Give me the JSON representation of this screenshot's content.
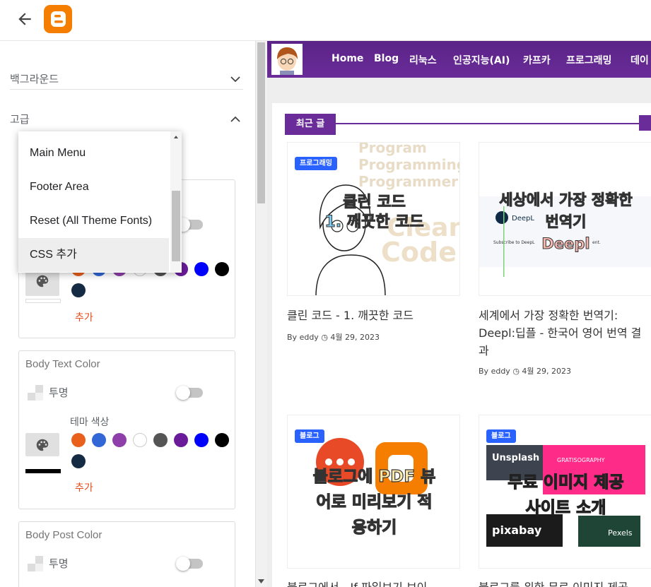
{
  "sidebar": {
    "sections": [
      {
        "label": "백그라운드",
        "expanded": false
      },
      {
        "label": "고급",
        "expanded": true
      }
    ],
    "dropdown": {
      "items": [
        "Main Menu",
        "Footer Area",
        "Reset (All Theme Fonts)",
        "CSS 추가"
      ],
      "selected": "CSS 추가"
    },
    "transparent_label": "투명",
    "theme_colors_label": "테마 색상",
    "add_label": "추가",
    "cards": [
      {
        "title": "",
        "swatches": [
          "#e8601c",
          "#3367d6",
          "#8e3fa9",
          "#ffffff",
          "#555555",
          "#6a1b9a",
          "#0000ff",
          "#000000",
          "#152a43"
        ]
      },
      {
        "title": "Body Text Color",
        "swatches": [
          "#e8601c",
          "#3367d6",
          "#8e3fa9",
          "#ffffff",
          "#555555",
          "#6a1b9a",
          "#0000ff",
          "#000000",
          "#152a43"
        ]
      },
      {
        "title": "Body Post Color"
      }
    ]
  },
  "preview": {
    "nav_items": [
      "Home",
      "Blog",
      "리눅스",
      "인공지능(AI)",
      "카프카",
      "프로그래밍",
      "데이"
    ],
    "section_heading": "최근 글",
    "posts": [
      {
        "label": "프로그래밍",
        "image_text": [
          "클린 코드",
          "1. 깨끗한 코드"
        ],
        "image_bg_words": [
          "Program",
          "Programming",
          "Programmer",
          "Clean",
          "Code"
        ],
        "title": "클린 코드 - 1. 깨끗한 코드",
        "author_prefix": "By",
        "author": "eddy",
        "date": "4월 29, 2023"
      },
      {
        "label": "",
        "image_text": [
          "세상에서 가장 정확한",
          "번역기",
          "Deepl"
        ],
        "image_small": [
          "DeepL",
          "Subscribe to DeepL",
          "ent."
        ],
        "title": "세계에서 가장 정확한 번역기: Deepl:딥플 - 한국어 영어 번역 결과",
        "author_prefix": "By",
        "author": "eddy",
        "date": "4월 29, 2023"
      },
      {
        "label": "블로그",
        "image_text": [
          "블로그에 PDF 뷰",
          "어로 미리보기 적",
          "용하기"
        ],
        "title": "블로그에서 - If 파일보기 보이",
        "author_prefix": "",
        "author": "",
        "date": ""
      },
      {
        "label": "블로그",
        "image_text": [
          "무료 이미지 제공",
          "사이트 소개"
        ],
        "image_small": [
          "Unsplash",
          "GRATISOGRAPHY",
          "pixabay",
          "Pexels"
        ],
        "title": "블로그를 위한 무료 이미지 제공",
        "author_prefix": "",
        "author": "",
        "date": ""
      }
    ]
  },
  "colors": {
    "nav_purple": "#6a2c98",
    "label_blue": "#2962ff",
    "add_orange": "#e64a19",
    "blogger_orange": "#f57d00"
  }
}
